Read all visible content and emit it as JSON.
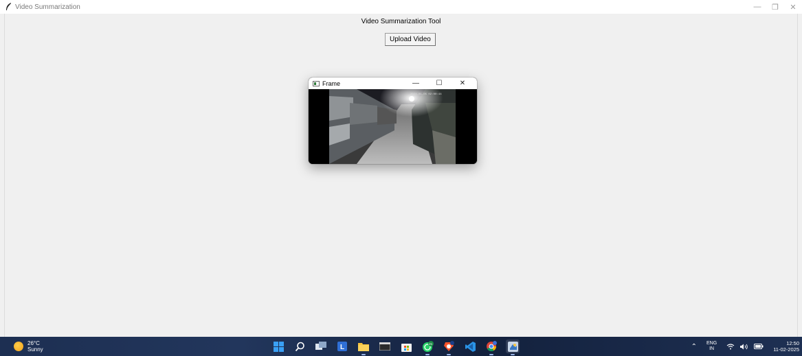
{
  "app": {
    "title": "Video Summarization",
    "heading": "Video Summarization Tool",
    "upload_label": "Upload Video",
    "controls": {
      "minimize": "—",
      "restore": "❐",
      "close": "✕"
    }
  },
  "frame_window": {
    "title": "Frame",
    "controls": {
      "minimize": "—",
      "maximize": "☐",
      "close": "✕"
    },
    "timestamp": "2024-01-05 02:00:44"
  },
  "taskbar": {
    "weather": {
      "temp": "26°C",
      "condition": "Sunny"
    },
    "apps": [
      {
        "name": "start-icon"
      },
      {
        "name": "search-icon"
      },
      {
        "name": "task-view-icon"
      },
      {
        "name": "launcher-l-icon"
      },
      {
        "name": "file-explorer-icon"
      },
      {
        "name": "terminal-icon"
      },
      {
        "name": "store-icon"
      },
      {
        "name": "whatsapp-icon",
        "badge": "21"
      },
      {
        "name": "brave-browser-icon"
      },
      {
        "name": "vscode-icon"
      },
      {
        "name": "chrome-icon"
      },
      {
        "name": "python-tkinter-icon"
      }
    ],
    "tray": {
      "lang_top": "ENG",
      "lang_bottom": "IN",
      "time": "12:50",
      "date": "11-02-2025"
    }
  },
  "colors": {
    "taskbar": "#1d2f52",
    "window_bg": "#f0f0f0",
    "accent": "#0078d4"
  }
}
